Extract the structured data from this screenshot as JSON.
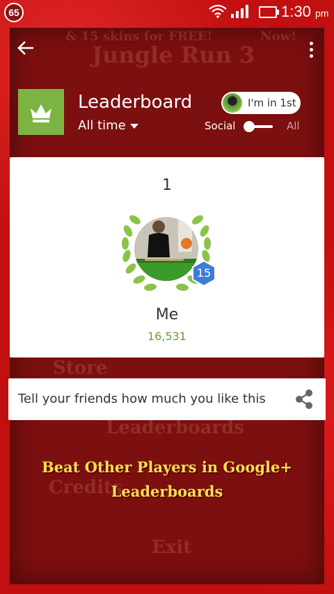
{
  "status_bar": {
    "notification_count": "65",
    "time": "1:30",
    "time_suffix": "pm"
  },
  "background_ghost": {
    "top_banner": "& 15 skins for FREE!",
    "top_banner_right": "Now!",
    "game_title": "Jungle Run 3",
    "menu_store": "Store",
    "menu_leaderboards": "Leaderboards",
    "menu_credits": "Credits",
    "menu_exit": "Exit"
  },
  "app_bar": {
    "back_icon": "arrow-back-icon",
    "more_icon": "more-vert-icon"
  },
  "leaderboard": {
    "icon": "crown-icon",
    "title": "Leaderboard",
    "time_filter": "All time",
    "rank_pill_label": "I'm in 1st",
    "social_label": "Social",
    "all_label": "All",
    "toggle_state": "social"
  },
  "player": {
    "rank": "1",
    "level": "15",
    "name": "Me",
    "score": "16,531"
  },
  "share": {
    "text": "Tell your friends how much you like this",
    "icon": "share-icon"
  },
  "promo": {
    "line1": "Beat Other Players in Google+",
    "line2": "Leaderboards"
  },
  "colors": {
    "frame_red": "#c21010",
    "panel_dark_red": "#7c0f0f",
    "leaderboard_green": "#7cb342",
    "score_green": "#689f38",
    "badge_blue": "#3b7dd8",
    "promo_yellow": "#f5e04a"
  }
}
